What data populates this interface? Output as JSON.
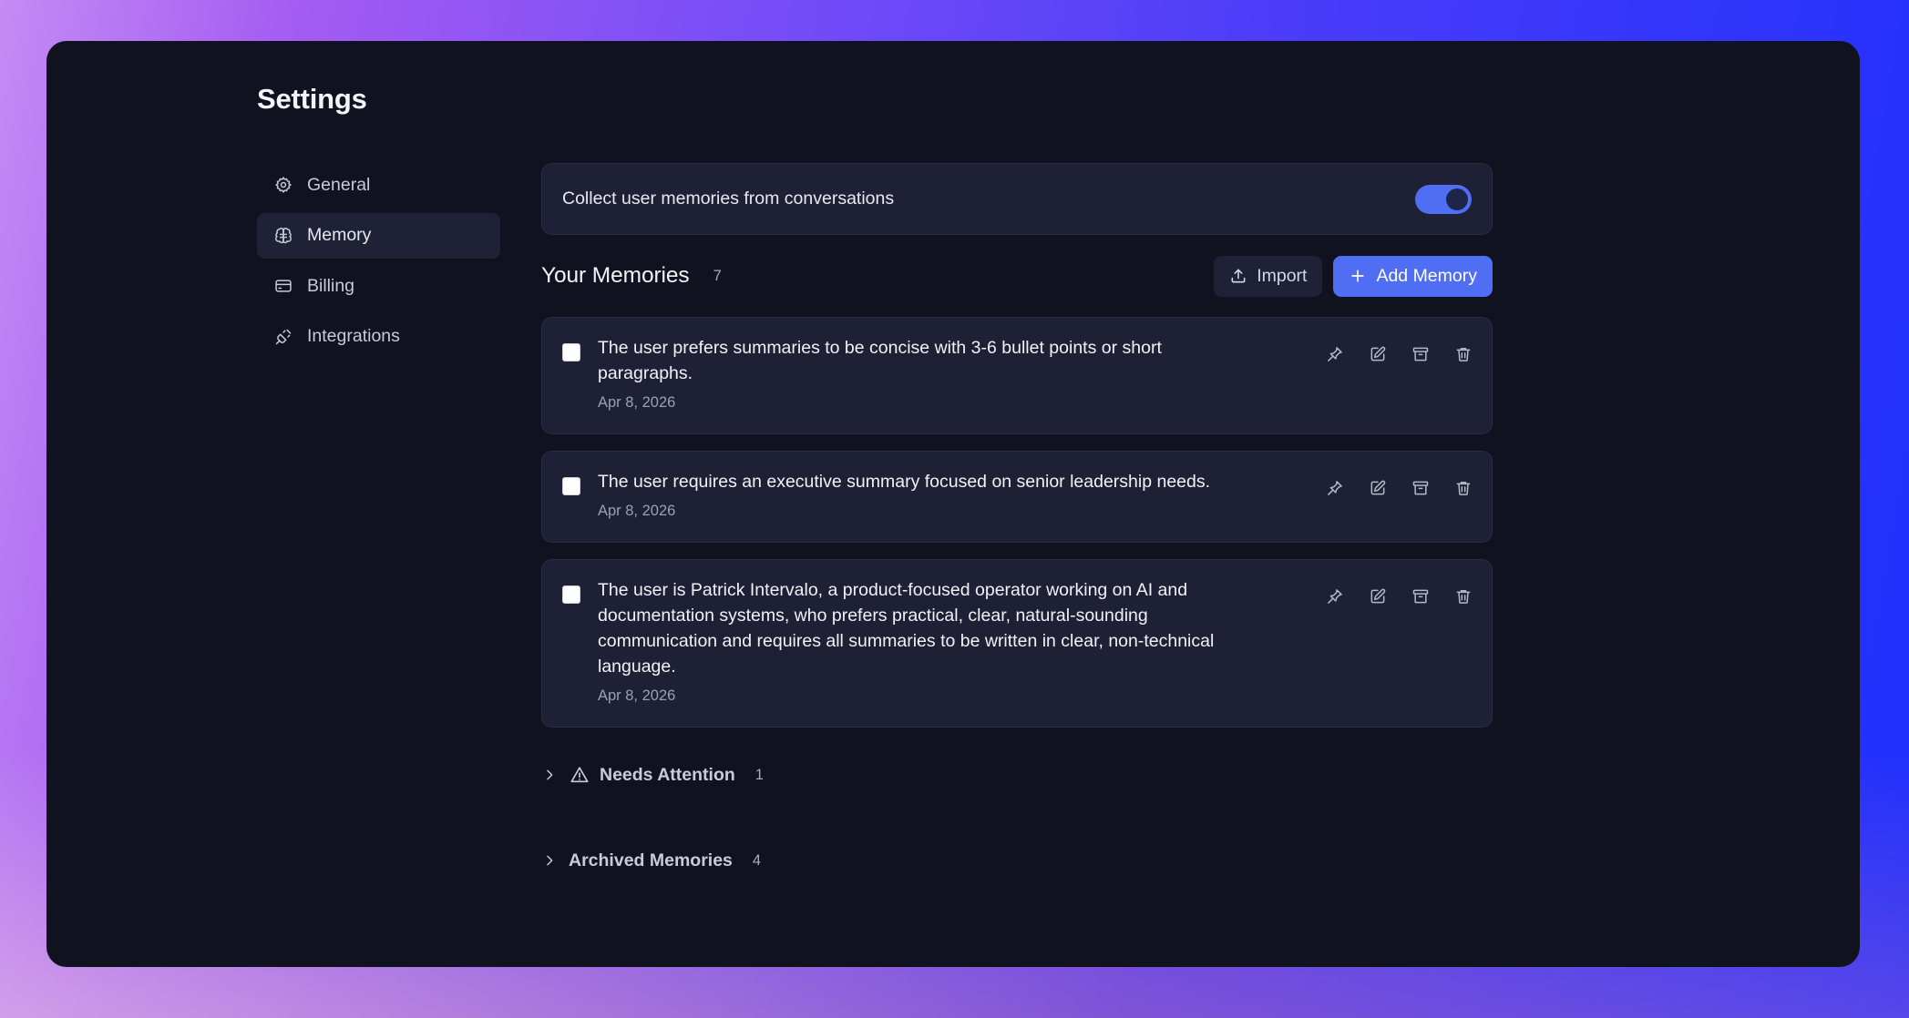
{
  "page": {
    "title": "Settings"
  },
  "sidebar": {
    "items": [
      {
        "label": "General",
        "icon": "gear-icon",
        "active": false
      },
      {
        "label": "Memory",
        "icon": "brain-icon",
        "active": true
      },
      {
        "label": "Billing",
        "icon": "credit-card-icon",
        "active": false
      },
      {
        "label": "Integrations",
        "icon": "plug-icon",
        "active": false
      }
    ]
  },
  "memory_settings": {
    "collect_label": "Collect user memories from conversations",
    "collect_enabled": true
  },
  "memories": {
    "title": "Your Memories",
    "count": "7",
    "import_label": "Import",
    "add_label": "Add Memory",
    "items": [
      {
        "text": "The user prefers summaries to be concise with 3-6 bullet points or short paragraphs.",
        "date": "Apr 8, 2026",
        "checked": false
      },
      {
        "text": "The user requires an executive summary focused on senior leadership needs.",
        "date": "Apr 8, 2026",
        "checked": false
      },
      {
        "text": "The user is Patrick Intervalo, a product-focused operator working on AI and documentation systems, who prefers practical, clear, natural-sounding communication and requires all summaries to be written in clear, non-technical language.",
        "date": "Apr 8, 2026",
        "checked": false
      }
    ],
    "actions": [
      "pin-icon",
      "edit-icon",
      "archive-icon",
      "trash-icon"
    ]
  },
  "sections": {
    "needs_attention": {
      "label": "Needs Attention",
      "count": "1"
    },
    "archived": {
      "label": "Archived Memories",
      "count": "4"
    }
  },
  "colors": {
    "accent": "#4f6ef4",
    "window_bg": "#10131f",
    "card_bg": "#1e2035"
  }
}
